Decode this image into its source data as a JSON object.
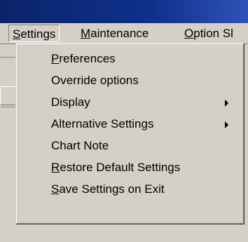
{
  "menubar": {
    "items": [
      {
        "label_pre": "",
        "label_u": "S",
        "label_post": "ettings",
        "active": true
      },
      {
        "label_pre": "",
        "label_u": "M",
        "label_post": "aintenance"
      },
      {
        "label_pre": "",
        "label_u": "O",
        "label_post": "ption Sl"
      }
    ]
  },
  "menu": {
    "items": [
      {
        "label_pre": "",
        "label_u": "P",
        "label_post": "references",
        "submenu": false
      },
      {
        "label_pre": "Override options",
        "label_u": "",
        "label_post": "",
        "submenu": false
      },
      {
        "label_pre": "Display",
        "label_u": "",
        "label_post": "",
        "submenu": true
      },
      {
        "label_pre": "Alternative Settings",
        "label_u": "",
        "label_post": "",
        "submenu": true
      },
      {
        "label_pre": "Chart Note",
        "label_u": "",
        "label_post": "",
        "submenu": false
      },
      {
        "label_pre": "",
        "label_u": "R",
        "label_post": "estore Default Settings",
        "submenu": false
      },
      {
        "label_pre": "",
        "label_u": "S",
        "label_post": "ave Settings on Exit",
        "submenu": false
      }
    ],
    "submenu_arrow_icon": "triangle-right-icon"
  },
  "colors": {
    "titlebar": "#0a246a",
    "menu_bg": "#d4d0c8"
  }
}
